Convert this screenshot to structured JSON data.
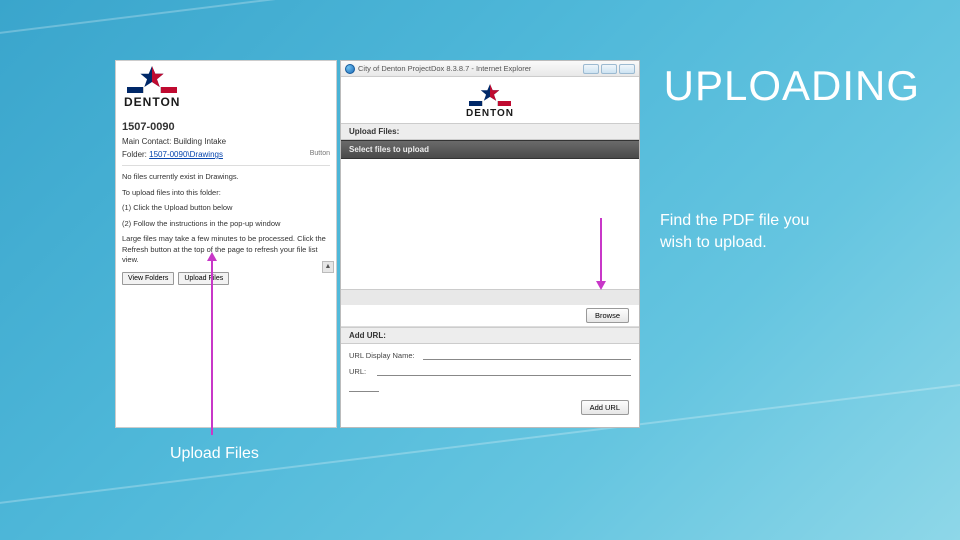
{
  "slide": {
    "title": "UPLOADING",
    "callout_find": "Find the PDF file you\nwish to upload.",
    "callout_upload": "Upload Files"
  },
  "left_window": {
    "logo_text": "DENTON",
    "project_id": "1507-0090",
    "main_contact": "Main Contact: Building Intake",
    "folder_label": "Folder:",
    "folder_link": "1507-0090\\Drawings",
    "no_files": "No files currently exist in Drawings.",
    "upload_intro": "To upload files into this folder:",
    "step1": "(1) Click the Upload button below",
    "step2": "(2) Follow the instructions in the pop-up window",
    "large_files": "Large files may take a few minutes to be processed. Click the Refresh button at the top of the page to refresh your file list view.",
    "btn_view": "View Folders",
    "btn_upload": "Upload Files",
    "button_label_partial": "Button"
  },
  "right_window": {
    "titlebar": "City of Denton ProjectDox 8.3.8.7 - Internet Explorer",
    "logo_text": "DENTON",
    "upload_files_head": "Upload Files:",
    "select_files": "Select files to upload",
    "browse": "Browse",
    "add_url_head": "Add URL:",
    "url_display_label": "URL Display Name:",
    "url_label": "URL:",
    "add_url_btn": "Add URL"
  }
}
